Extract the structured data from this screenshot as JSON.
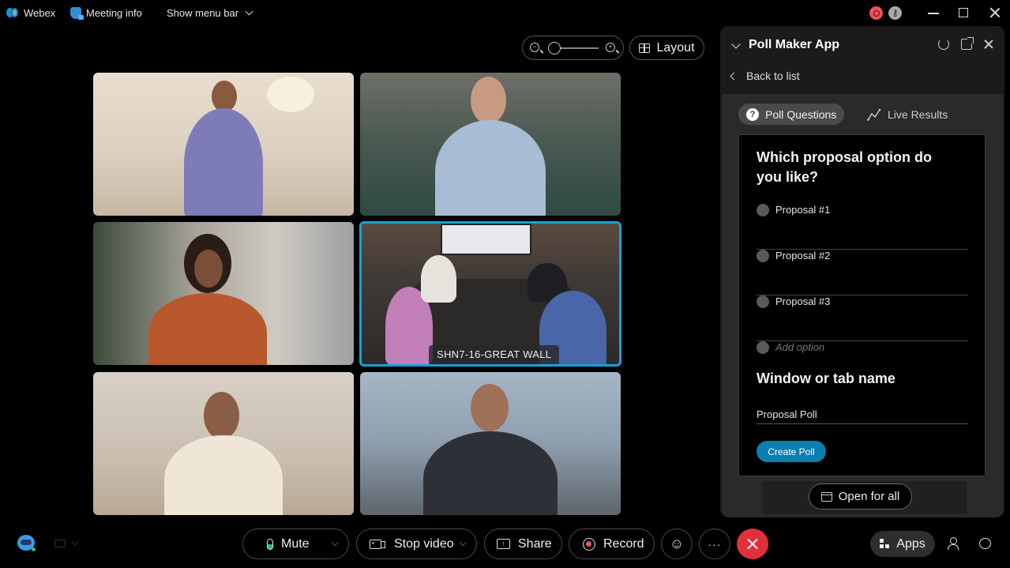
{
  "titlebar": {
    "app_name": "Webex",
    "meeting_info": "Meeting info",
    "show_menu_bar": "Show menu bar",
    "key_glyph": "⚷"
  },
  "view_controls": {
    "layout_label": "Layout",
    "zoom_minus": "−",
    "zoom_plus": "+"
  },
  "video_tiles": [
    {
      "id": 1,
      "name_label": ""
    },
    {
      "id": 2,
      "name_label": ""
    },
    {
      "id": 3,
      "name_label": ""
    },
    {
      "id": 4,
      "name_label": "SHN7-16-GREAT WALL",
      "active_speaker": true
    },
    {
      "id": 5,
      "name_label": ""
    },
    {
      "id": 6,
      "name_label": ""
    }
  ],
  "panel": {
    "title": "Poll Maker App",
    "back_label": "Back to list",
    "tabs": [
      {
        "label": "Poll Questions",
        "active": true
      },
      {
        "label": "Live Results",
        "active": false
      }
    ],
    "question": "Which proposal option do you like?",
    "options": [
      "Proposal #1",
      "Proposal #2",
      "Proposal #3"
    ],
    "add_option_placeholder": "Add option",
    "window_name_title": "Window or tab name",
    "window_name_value": "Proposal Poll",
    "create_button": "Create Poll",
    "open_for_all": "Open for all"
  },
  "toolbar": {
    "mute": "Mute",
    "stop_video": "Stop video",
    "share": "Share",
    "record": "Record",
    "react_glyph": "☺",
    "more_glyph": "···",
    "apps": "Apps"
  },
  "colors": {
    "accent": "#1aa0d8",
    "create_button": "#0b7fb0",
    "leave": "#e0303c",
    "record_dot": "#f0505a",
    "mic_level": "#1fb8a0"
  }
}
